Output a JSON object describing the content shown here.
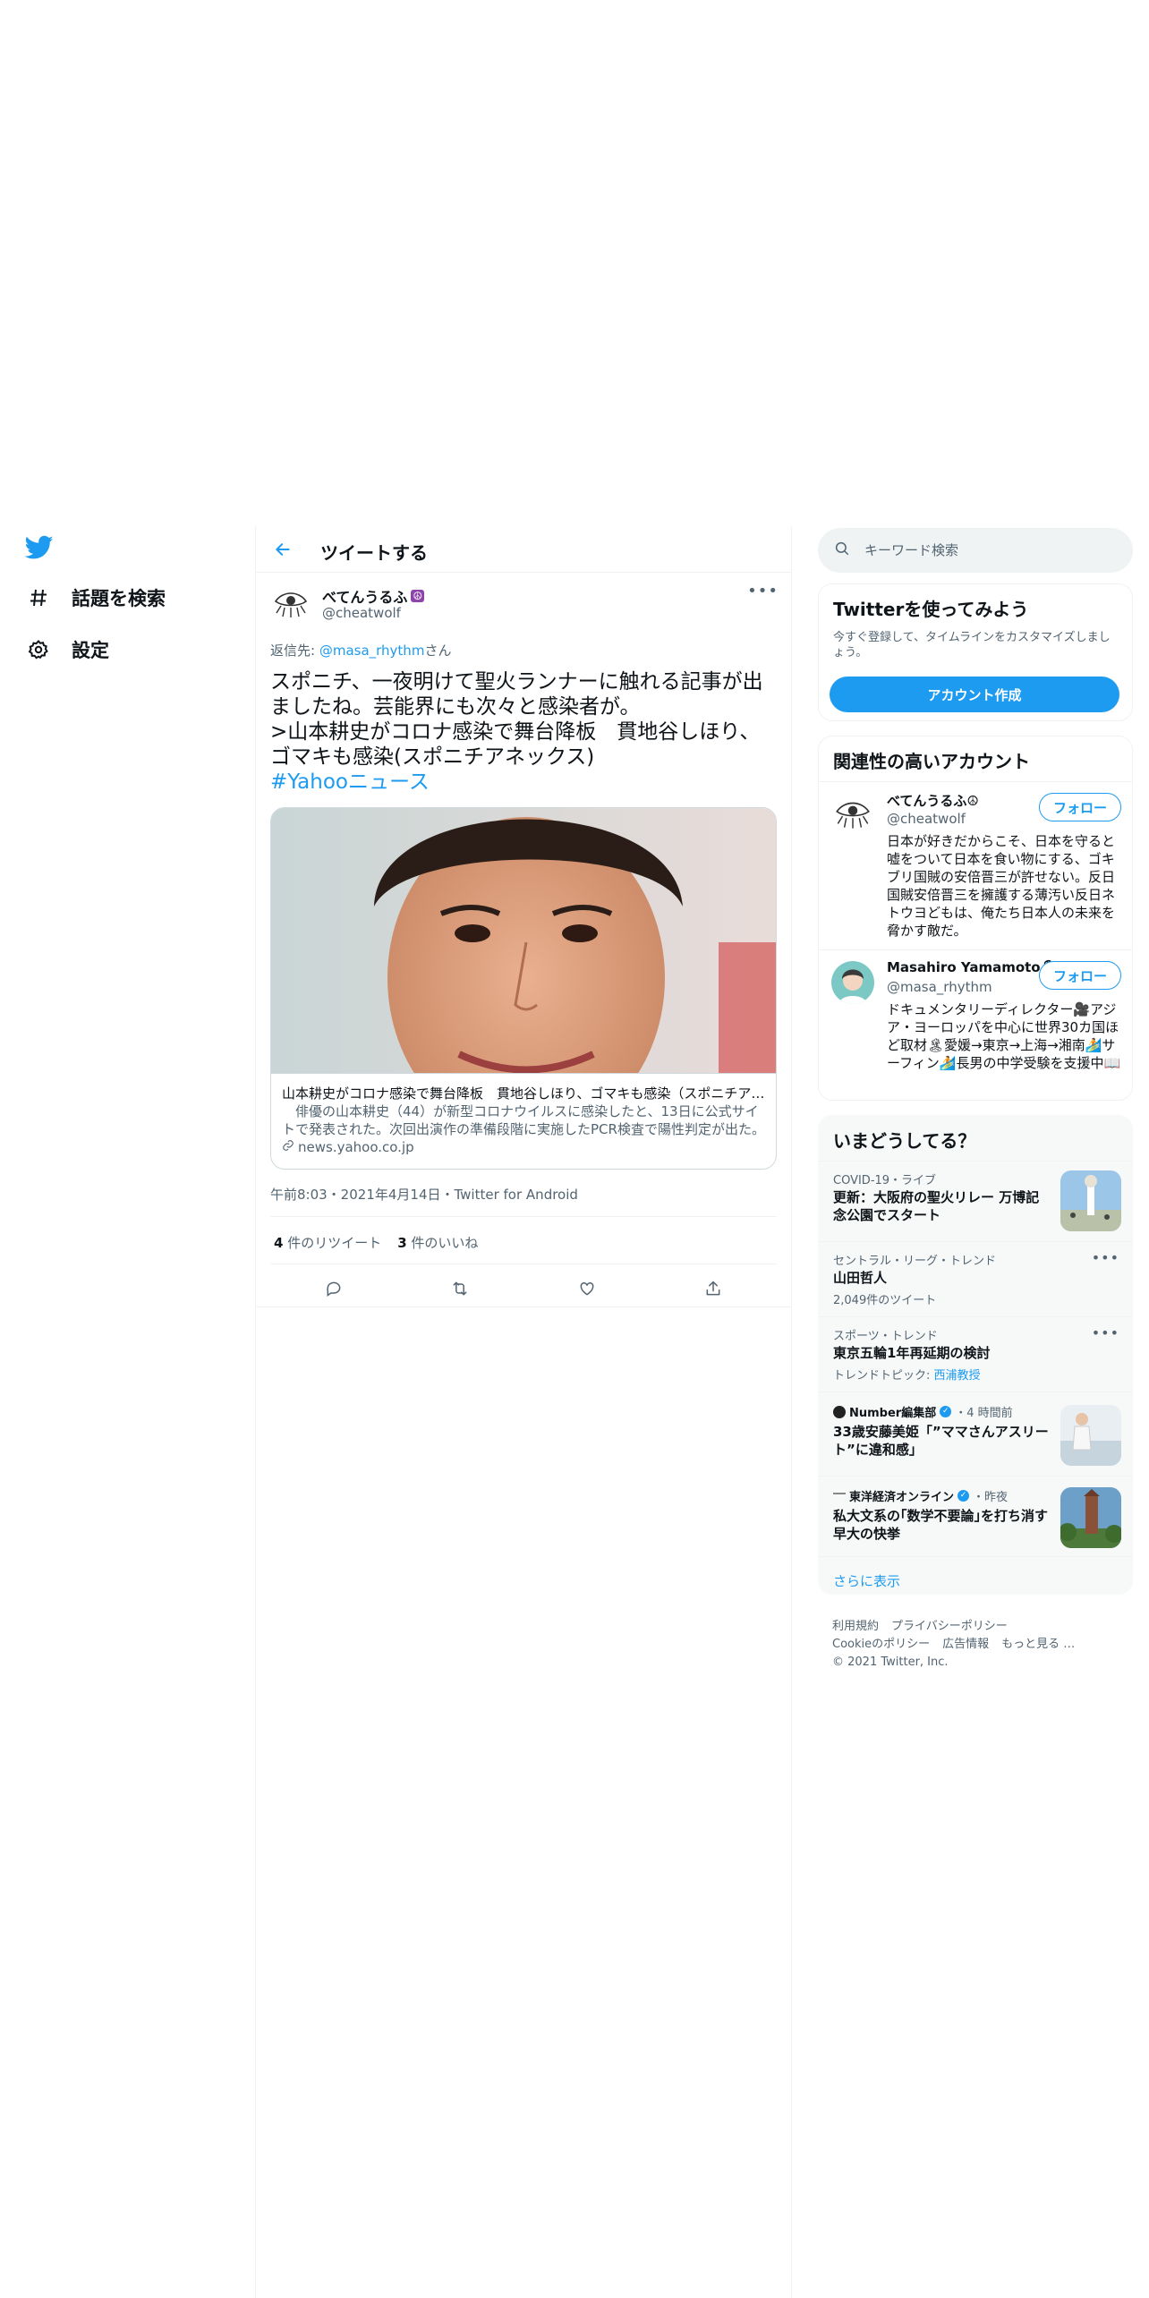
{
  "nav": {
    "logo": "twitter-bird-icon",
    "items": [
      {
        "label": "話題を検索",
        "icon": "hashtag-icon"
      },
      {
        "label": "設定",
        "icon": "gear-icon"
      }
    ]
  },
  "main": {
    "title": "ツイートする",
    "tweet": {
      "name": "べてんうるふ",
      "name_emoji": "☮",
      "handle": "@cheatwolf",
      "reply_prefix": "返信先: ",
      "reply_to": "@masa_rhythm",
      "reply_suffix": "さん",
      "text_lines": [
        "スポニチ、一夜明けて聖火ランナーに触れる記事が出",
        "ましたね。芸能界にも次々と感染者が。",
        ">山本耕史がコロナ感染で舞台降板　貫地谷しほり、",
        "ゴマキも感染(スポニチアネックス)"
      ],
      "hashtag": "#Yahooニュース",
      "card": {
        "title": "山本耕史がコロナ感染で舞台降板　貫地谷しほり、ゴマキも感染（スポニチアネックス）",
        "description": "　俳優の山本耕史（44）が新型コロナウイルスに感染したと、13日に公式サイトで発表された。次回出演作の準備段階に実施したPCR検査で陽性判定が出た。",
        "domain": "news.yahoo.co.jp"
      },
      "meta": "午前8:03・2021年4月14日・Twitter for Android",
      "retweets_count": "4",
      "retweets_label": " 件のリツイート",
      "likes_count": "3",
      "likes_label": " 件のいいね",
      "actions": [
        "reply-icon",
        "retweet-icon",
        "like-icon",
        "share-icon"
      ]
    }
  },
  "right": {
    "search_placeholder": "キーワード検索",
    "signup": {
      "title": "Twitterを使ってみよう",
      "subtitle": "今すぐ登録して、タイムラインをカスタマイズしましょう。",
      "button": "アカウント作成"
    },
    "relevant": {
      "title": "関連性の高いアカウント",
      "accounts": [
        {
          "name": "べてんうるふ☮",
          "handle": "@cheatwolf",
          "follow": "フォロー",
          "bio": "日本が好きだからこそ、日本を守ると嘘をついて日本を食い物にする、ゴキブリ国賊の安倍晋三が許せない。反日国賊安倍晋三を擁護する薄汚い反日ネトウヨどもは、俺たち日本人の未来を脅かす敵だ。"
        },
        {
          "name": "Masahiro Yamamoto🎙",
          "handle": "@masa_rhythm",
          "follow": "フォロー",
          "bio": "ドキュメンタリーディレクター🎥アジア・ヨーロッパを中心に世界30カ国ほど取材🏝愛媛→東京→上海→湘南🏄サーフィン🏄長男の中学受験を支援中📖"
        }
      ]
    },
    "trends": {
      "title": "いまどうしてる？",
      "items": [
        {
          "context": "COVID-19・ライブ",
          "title": "更新：大阪府の聖火リレー 万博記念公園でスタート"
        },
        {
          "context": "セントラル・リーグ・トレンド",
          "title": "山田哲人",
          "sub": "2,049件のツイート"
        },
        {
          "context": "スポーツ・トレンド",
          "title": "東京五輪1年再延期の検討",
          "sub_prefix": "トレンドトピック: ",
          "sub_link": "西浦教授"
        },
        {
          "source": "Number編集部",
          "time": "・4 時間前",
          "title": "33歳安藤美姫「”ママさんアスリート”に違和感」"
        },
        {
          "source": "東洋経済オンライン",
          "time": "・昨夜",
          "title": "私大文系の｢数学不要論｣を打ち消す早大の快挙"
        }
      ],
      "show_more": "さらに表示"
    },
    "footer": {
      "links_row1": [
        "利用規約",
        "プライバシーポリシー"
      ],
      "links_row2": [
        "Cookieのポリシー",
        "広告情報",
        "もっと見る …"
      ],
      "copyright": "© 2021 Twitter, Inc."
    }
  },
  "colors": {
    "accent": "#1d9bf0",
    "text": "#0f1419",
    "secondary": "#536471",
    "border": "#eff3f4"
  }
}
